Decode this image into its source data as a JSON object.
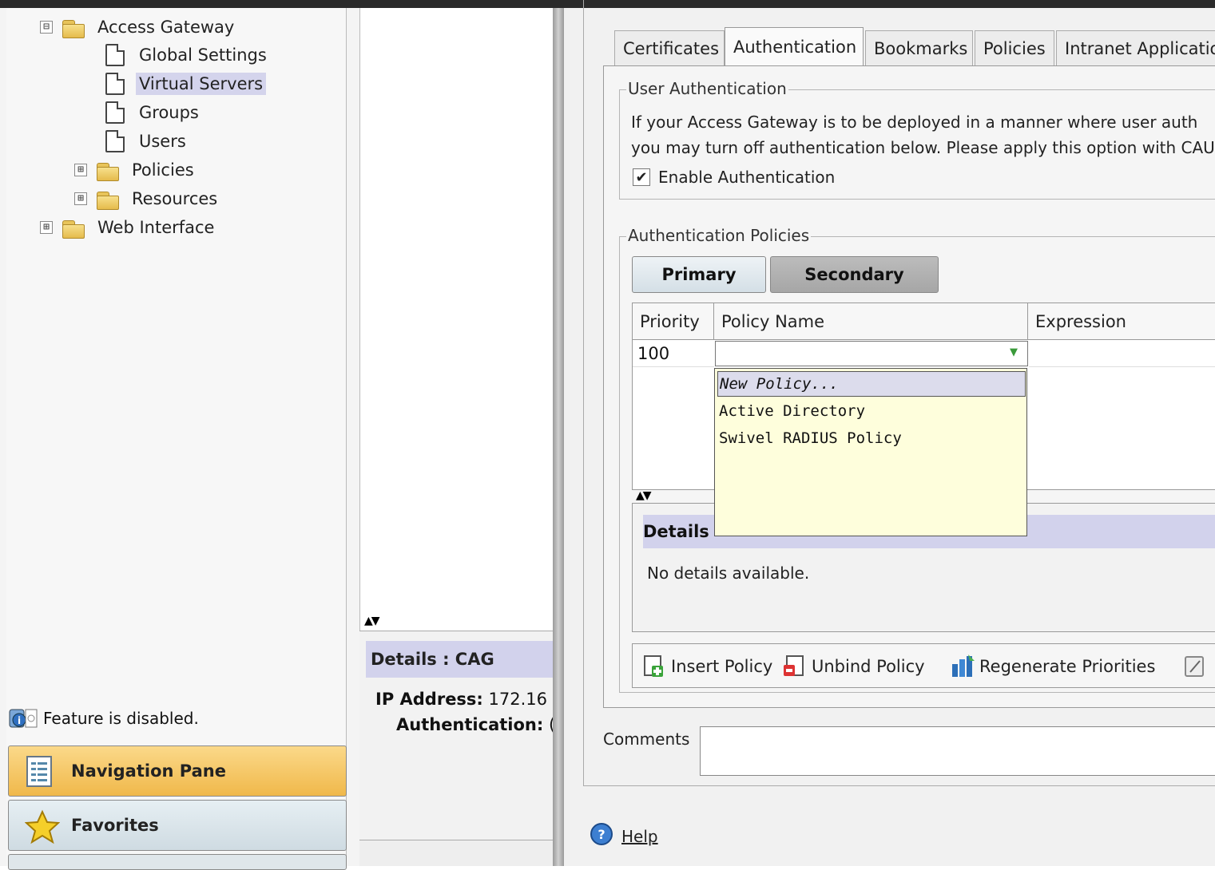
{
  "nav": {
    "tree": [
      {
        "label": "Access Gateway",
        "expander": "⊟"
      },
      {
        "label": "Global Settings"
      },
      {
        "label": "Virtual Servers"
      },
      {
        "label": "Groups"
      },
      {
        "label": "Users"
      },
      {
        "label": "Policies",
        "expander": "⊞"
      },
      {
        "label": "Resources",
        "expander": "⊞"
      },
      {
        "label": "Web Interface",
        "expander": "⊞"
      }
    ],
    "status": "Feature is disabled.",
    "navigation_pane": "Navigation Pane",
    "favorites": "Favorites"
  },
  "mid": {
    "details_title": "Details : CAG",
    "ip_label": "IP Address:",
    "ip_value": "172.16",
    "auth_label": "Authentication:",
    "auth_value": "("
  },
  "dialog": {
    "tabs": [
      "Certificates",
      "Authentication",
      "Bookmarks",
      "Policies",
      "Intranet Application"
    ],
    "user_auth": {
      "legend": "User Authentication",
      "line1": "If your Access Gateway is to be deployed in a manner where user auth",
      "line2": "you may turn off authentication below. Please apply this option with CAU",
      "checkbox_label": "Enable Authentication",
      "checked": true
    },
    "auth_policies": {
      "legend": "Authentication Policies",
      "primary": "Primary",
      "secondary": "Secondary",
      "columns": [
        "Priority",
        "Policy Name",
        "Expression"
      ],
      "row_priority": "100",
      "dropdown_options": [
        "New Policy...",
        "Active Directory",
        "Swivel RADIUS Policy"
      ],
      "details_title": "Details",
      "details_text": "No details available."
    },
    "toolbar": {
      "insert": "Insert Policy",
      "unbind": "Unbind Policy",
      "regenerate": "Regenerate Priorities"
    },
    "comments_label": "Comments",
    "help": "Help"
  },
  "colors": {
    "selection": "#d4d4ec",
    "dropdown_bg": "#fefedc",
    "nav_pane_button": "#f0b84a"
  }
}
